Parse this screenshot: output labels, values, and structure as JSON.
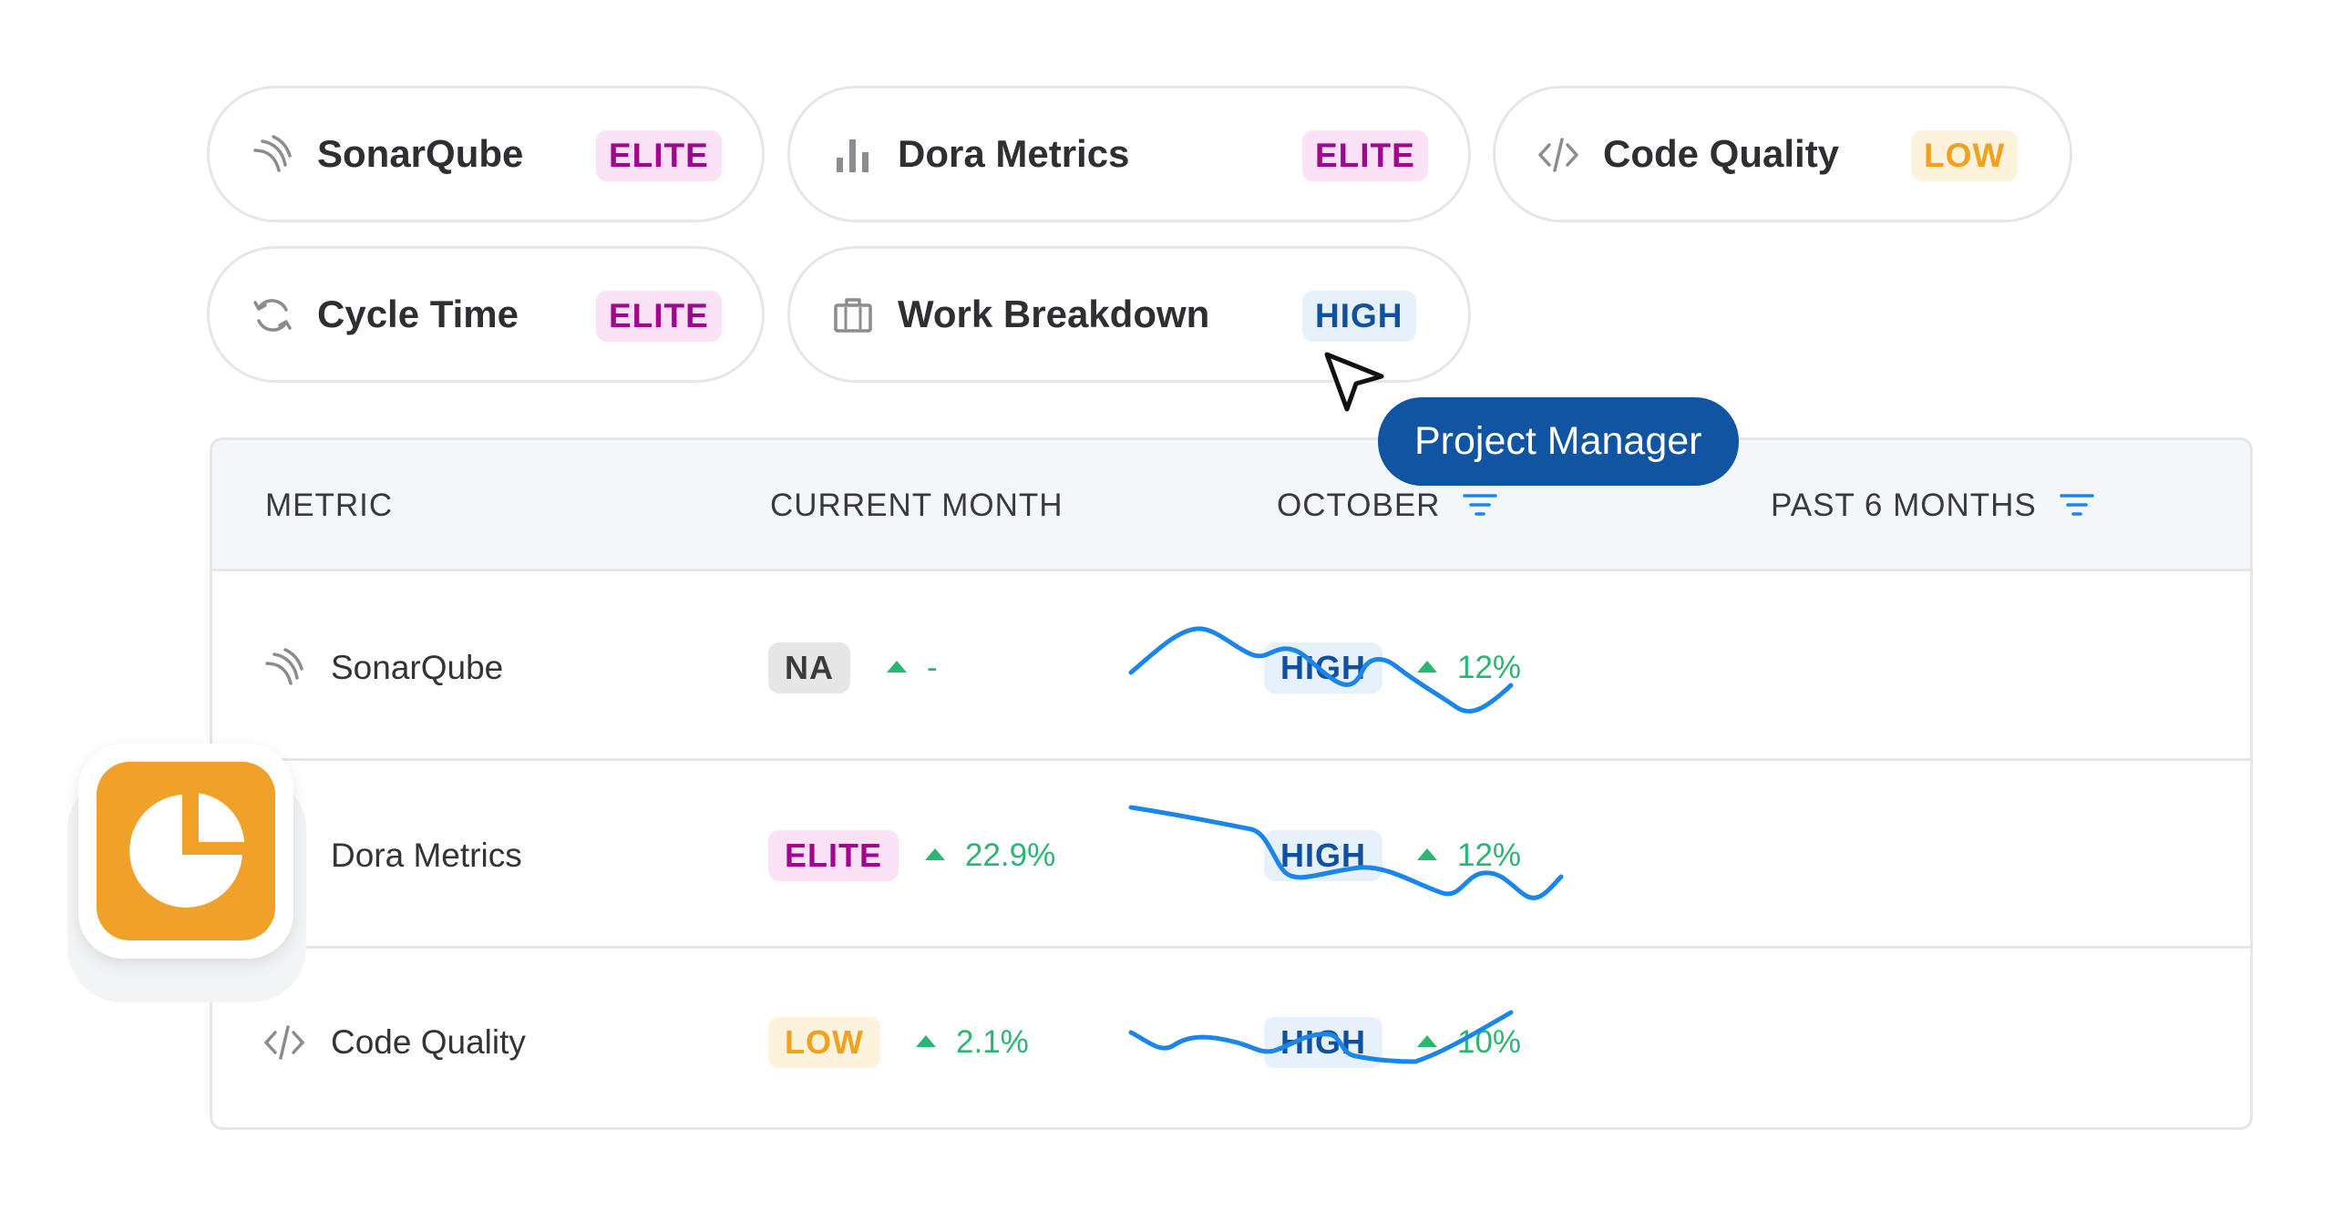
{
  "pills": [
    {
      "label": "SonarQube",
      "badge": "ELITE",
      "icon": "sonarqube-icon"
    },
    {
      "label": "Dora Metrics",
      "badge": "ELITE",
      "icon": "bar-chart-icon"
    },
    {
      "label": "Code Quality",
      "badge": "LOW",
      "icon": "code-icon"
    },
    {
      "label": "Cycle Time",
      "badge": "ELITE",
      "icon": "refresh-icon"
    },
    {
      "label": "Work Breakdown",
      "badge": "HIGH",
      "icon": "briefcase-icon"
    }
  ],
  "tooltip": {
    "text": "Project Manager"
  },
  "table": {
    "headers": {
      "metric": "METRIC",
      "current_month": "CURRENT MONTH",
      "october": "OCTOBER",
      "past_6_months": "PAST 6 MONTHS"
    },
    "rows": [
      {
        "metric": "SonarQube",
        "icon": "sonarqube-icon",
        "current_badge": "NA",
        "current_change": "-",
        "october_badge": "HIGH",
        "october_change": "12%"
      },
      {
        "metric": "Dora Metrics",
        "icon": "bar-chart-icon",
        "current_badge": "ELITE",
        "current_change": "22.9%",
        "october_badge": "HIGH",
        "october_change": "12%"
      },
      {
        "metric": "Code Quality",
        "icon": "code-icon",
        "current_badge": "LOW",
        "current_change": "2.1%",
        "october_badge": "HIGH",
        "october_change": "10%"
      }
    ]
  },
  "colors": {
    "elite": "#a1078d",
    "high": "#11509e",
    "low": "#f0a21f",
    "positive": "#2bb673",
    "sparkline": "#1a86ec",
    "tooltip": "#1054a2",
    "app_icon": "#f0a12a"
  },
  "app_icon": {
    "icon": "pie-chart-icon"
  }
}
